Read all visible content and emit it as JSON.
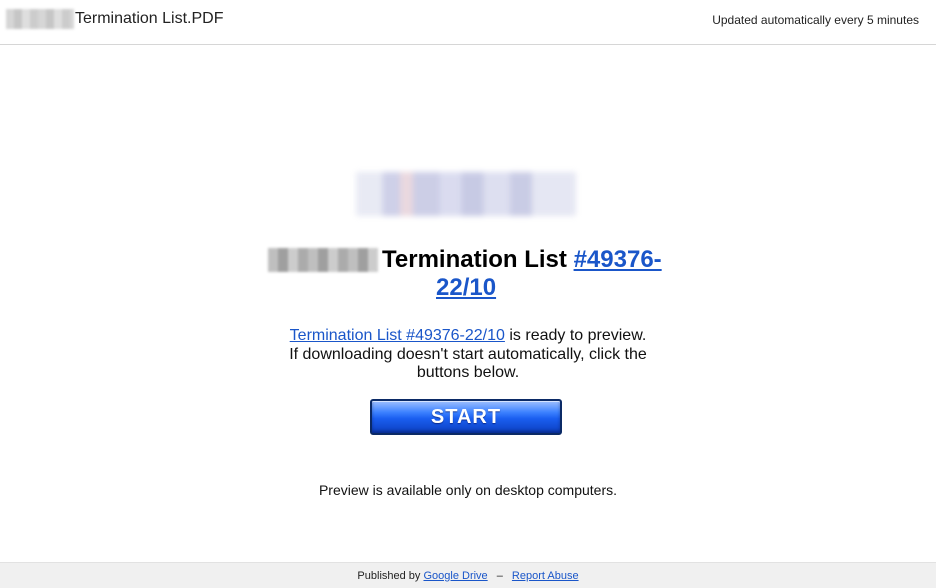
{
  "header": {
    "doc_title": "Termination List.PDF",
    "update_note": "Updated automatically every 5 minutes"
  },
  "main": {
    "heading_text": "Termination List",
    "heading_link_part1": "#49376-",
    "heading_link_part2": "22/10",
    "message_link": "Termination List #49376-22/10",
    "message_line1_suffix": " is ready to preview.",
    "message_line2": "If downloading doesn't start automatically, click the",
    "message_line3": "buttons below.",
    "start_button_label": "START",
    "preview_note": "Preview is available only on desktop computers."
  },
  "footer": {
    "published_by_prefix": "Published by",
    "google_drive_link": "Google Drive",
    "separator": "–",
    "report_abuse_link": "Report Abuse"
  },
  "colors": {
    "link": "#1a56c9",
    "button_blue": "#1a5ef0",
    "footer_bg": "#f0f0f0"
  }
}
